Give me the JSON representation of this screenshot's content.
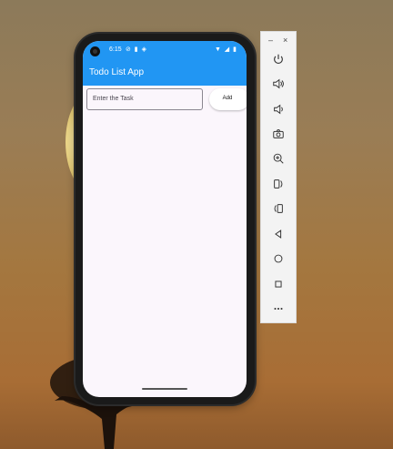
{
  "status_bar": {
    "time": "6:15",
    "left_icons": [
      "no-disturb-icon",
      "sim-card-icon",
      "location-icon"
    ],
    "right_icons": [
      "wifi-icon",
      "signal-icon",
      "battery-icon"
    ]
  },
  "app": {
    "title": "Todo List App",
    "task_input": {
      "placeholder": "Enter the Task",
      "value": ""
    },
    "add_button": "Add"
  },
  "toolbar": {
    "window_controls": {
      "minimize": "–",
      "close": "×"
    },
    "buttons": [
      "power-icon",
      "volume-up-icon",
      "volume-down-icon",
      "camera-icon",
      "zoom-icon",
      "rotate-left-icon",
      "rotate-right-icon",
      "back-icon",
      "home-icon",
      "overview-icon",
      "more-icon"
    ]
  },
  "colors": {
    "app_bar": "#2196f3",
    "screen_bg": "#fbf6fc",
    "toolbar_bg": "#f3f3f3"
  }
}
